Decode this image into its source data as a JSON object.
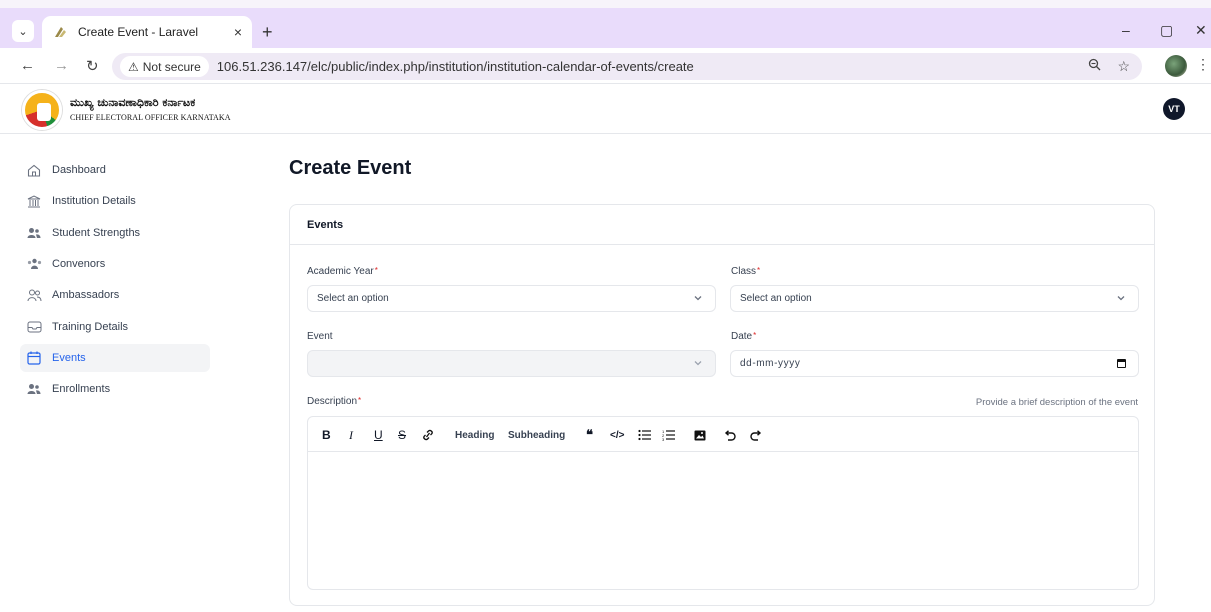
{
  "browser": {
    "tab_title": "Create Event - Laravel",
    "tab_close": "×",
    "new_tab": "+",
    "security_label": "Not secure",
    "url": "106.51.236.147/elc/public/index.php/institution/institution-calendar-of-events/create",
    "controls": {
      "minimize": "–",
      "maximize": "▢",
      "close": "✕"
    }
  },
  "header": {
    "org_name_kannada": "ಮುಖ್ಯ ಚುನಾವಣಾಧಿಕಾರಿ ಕರ್ನಾಟಕ",
    "org_name_english": "CHIEF ELECTORAL OFFICER KARNATAKA",
    "avatar_initials": "VT"
  },
  "sidebar": {
    "items": [
      {
        "label": "Dashboard",
        "icon": "home-icon"
      },
      {
        "label": "Institution Details",
        "icon": "building-icon"
      },
      {
        "label": "Student Strengths",
        "icon": "users-icon"
      },
      {
        "label": "Convenors",
        "icon": "users-group-icon"
      },
      {
        "label": "Ambassadors",
        "icon": "people-outline-icon"
      },
      {
        "label": "Training Details",
        "icon": "tray-icon"
      },
      {
        "label": "Events",
        "icon": "calendar-icon",
        "active": true
      },
      {
        "label": "Enrollments",
        "icon": "users-icon"
      }
    ]
  },
  "main": {
    "page_title": "Create Event",
    "card_title": "Events",
    "form": {
      "academic_year_label": "Academic Year",
      "academic_year_value": "Select an option",
      "class_label": "Class",
      "class_value": "Select an option",
      "event_label": "Event",
      "event_value": "",
      "date_label": "Date",
      "date_placeholder": "dd-mm-yyyy",
      "description_label": "Description",
      "description_hint": "Provide a brief description of the event",
      "required_mark": "*"
    },
    "toolbar": {
      "bold": "B",
      "italic": "I",
      "underline": "U",
      "strike": "S",
      "link": "⊘",
      "heading": "Heading",
      "subheading": "Subheading",
      "quote": "❝",
      "code": "</>",
      "bullet_list": "☰",
      "ordered_list": "☷",
      "image": "▣",
      "undo": "↶",
      "redo": "↷"
    }
  },
  "colors": {
    "accent": "#2563eb",
    "required": "#dc2626",
    "tabbar": "#e9dcfb"
  }
}
